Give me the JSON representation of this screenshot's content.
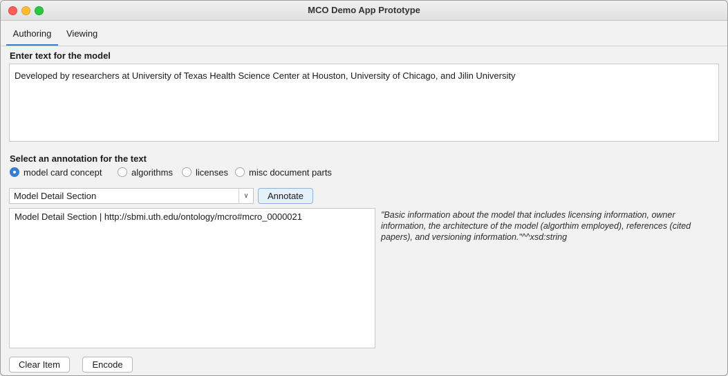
{
  "window": {
    "title": "MCO Demo App Prototype"
  },
  "tabs": [
    {
      "label": "Authoring",
      "selected": true
    },
    {
      "label": "Viewing",
      "selected": false
    }
  ],
  "text_section": {
    "label": "Enter text for the model",
    "value": "Developed by researchers at University of Texas Health Science Center at Houston, University of Chicago, and Jilin University"
  },
  "annotation_section": {
    "label": "Select an annotation for the text",
    "options": [
      {
        "label": "model card concept",
        "selected": true
      },
      {
        "label": "algorithms",
        "selected": false
      },
      {
        "label": "licenses",
        "selected": false
      },
      {
        "label": "misc document parts",
        "selected": false
      }
    ],
    "dropdown_value": "Model Detail Section",
    "annotate_label": "Annotate"
  },
  "results": {
    "items": [
      "Model Detail Section | http://sbmi.uth.edu/ontology/mcro#mcro_0000021"
    ],
    "description": "\"Basic information about the model that includes licensing information, owner information, the architecture of the model (algorthim employed), references (cited papers), and versioning information.\"^^xsd:string"
  },
  "buttons": {
    "clear_label": "Clear Item",
    "encode_label": "Encode"
  },
  "colors": {
    "accent": "#3a7bd5"
  }
}
